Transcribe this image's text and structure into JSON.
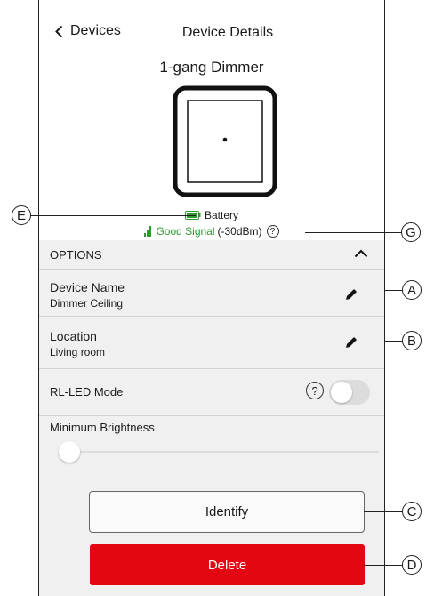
{
  "nav": {
    "back_label": "Devices",
    "title": "Device Details"
  },
  "device": {
    "name": "1-gang Dimmer"
  },
  "status": {
    "battery_label": "Battery",
    "signal_label": "Good Signal",
    "signal_value": "(-30dBm)",
    "signal_color": "#2f9a2f"
  },
  "options": {
    "header": "OPTIONS",
    "device_name_label": "Device Name",
    "device_name_value": "Dimmer Ceiling",
    "location_label": "Location",
    "location_value": "Living room",
    "rl_led_label": "RL-LED Mode",
    "rl_led_on": false,
    "min_brightness_label": "Minimum Brightness",
    "min_brightness_level": 0
  },
  "buttons": {
    "identify": "Identify",
    "delete": "Delete",
    "delete_color": "#e30613"
  },
  "callouts": {
    "a": "A",
    "b": "B",
    "c": "C",
    "d": "D",
    "e": "E",
    "g": "G"
  }
}
